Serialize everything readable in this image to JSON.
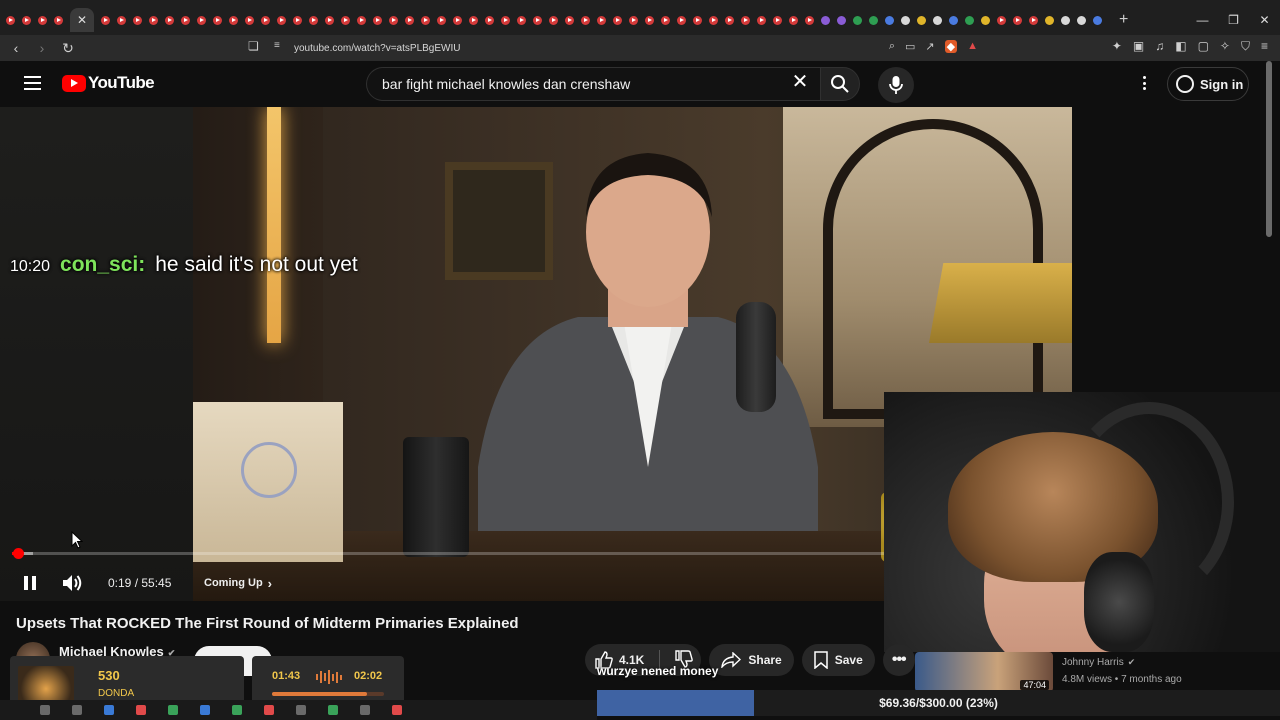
{
  "browser": {
    "url": "youtube.com/watch?v=atsPLBgEWIU",
    "active_tab_close": "✕",
    "new_tab": "+"
  },
  "masthead": {
    "logo_text": "YouTube",
    "search_value": "bar fight michael knowles dan crenshaw",
    "sign_in": "Sign in"
  },
  "player": {
    "chat": {
      "time": "10:20",
      "user": "con_sci:",
      "message": "he said it's not out yet"
    },
    "time_display": "0:19 / 55:45",
    "coming_up": "Coming Up",
    "progress_fraction": 0.006,
    "buffer_fraction": 0.02
  },
  "video": {
    "title": "Upsets That ROCKED The First Round of Midterm Primaries Explained",
    "channel": "Michael Knowles",
    "likes": "4.1K",
    "share": "Share",
    "save": "Save"
  },
  "recommendation": {
    "duration": "47:04",
    "channel": "Johnny Harris",
    "meta": "4.8M views • 7 months ago"
  },
  "overlay": {
    "song_count": "530",
    "album": "DONDA",
    "time_current": "01:43",
    "time_total": "02:02",
    "song_progress": 0.85,
    "donation_message": "wurzye nened money",
    "goal_label": "$69.36/$300.00 (23%)",
    "goal_fraction": 0.23
  },
  "colors": {
    "chat_user": "#7ee35b",
    "youtube_red": "#ff0000",
    "goal_fill": "#3f63a3",
    "overlay_gold": "#f1c74b"
  }
}
